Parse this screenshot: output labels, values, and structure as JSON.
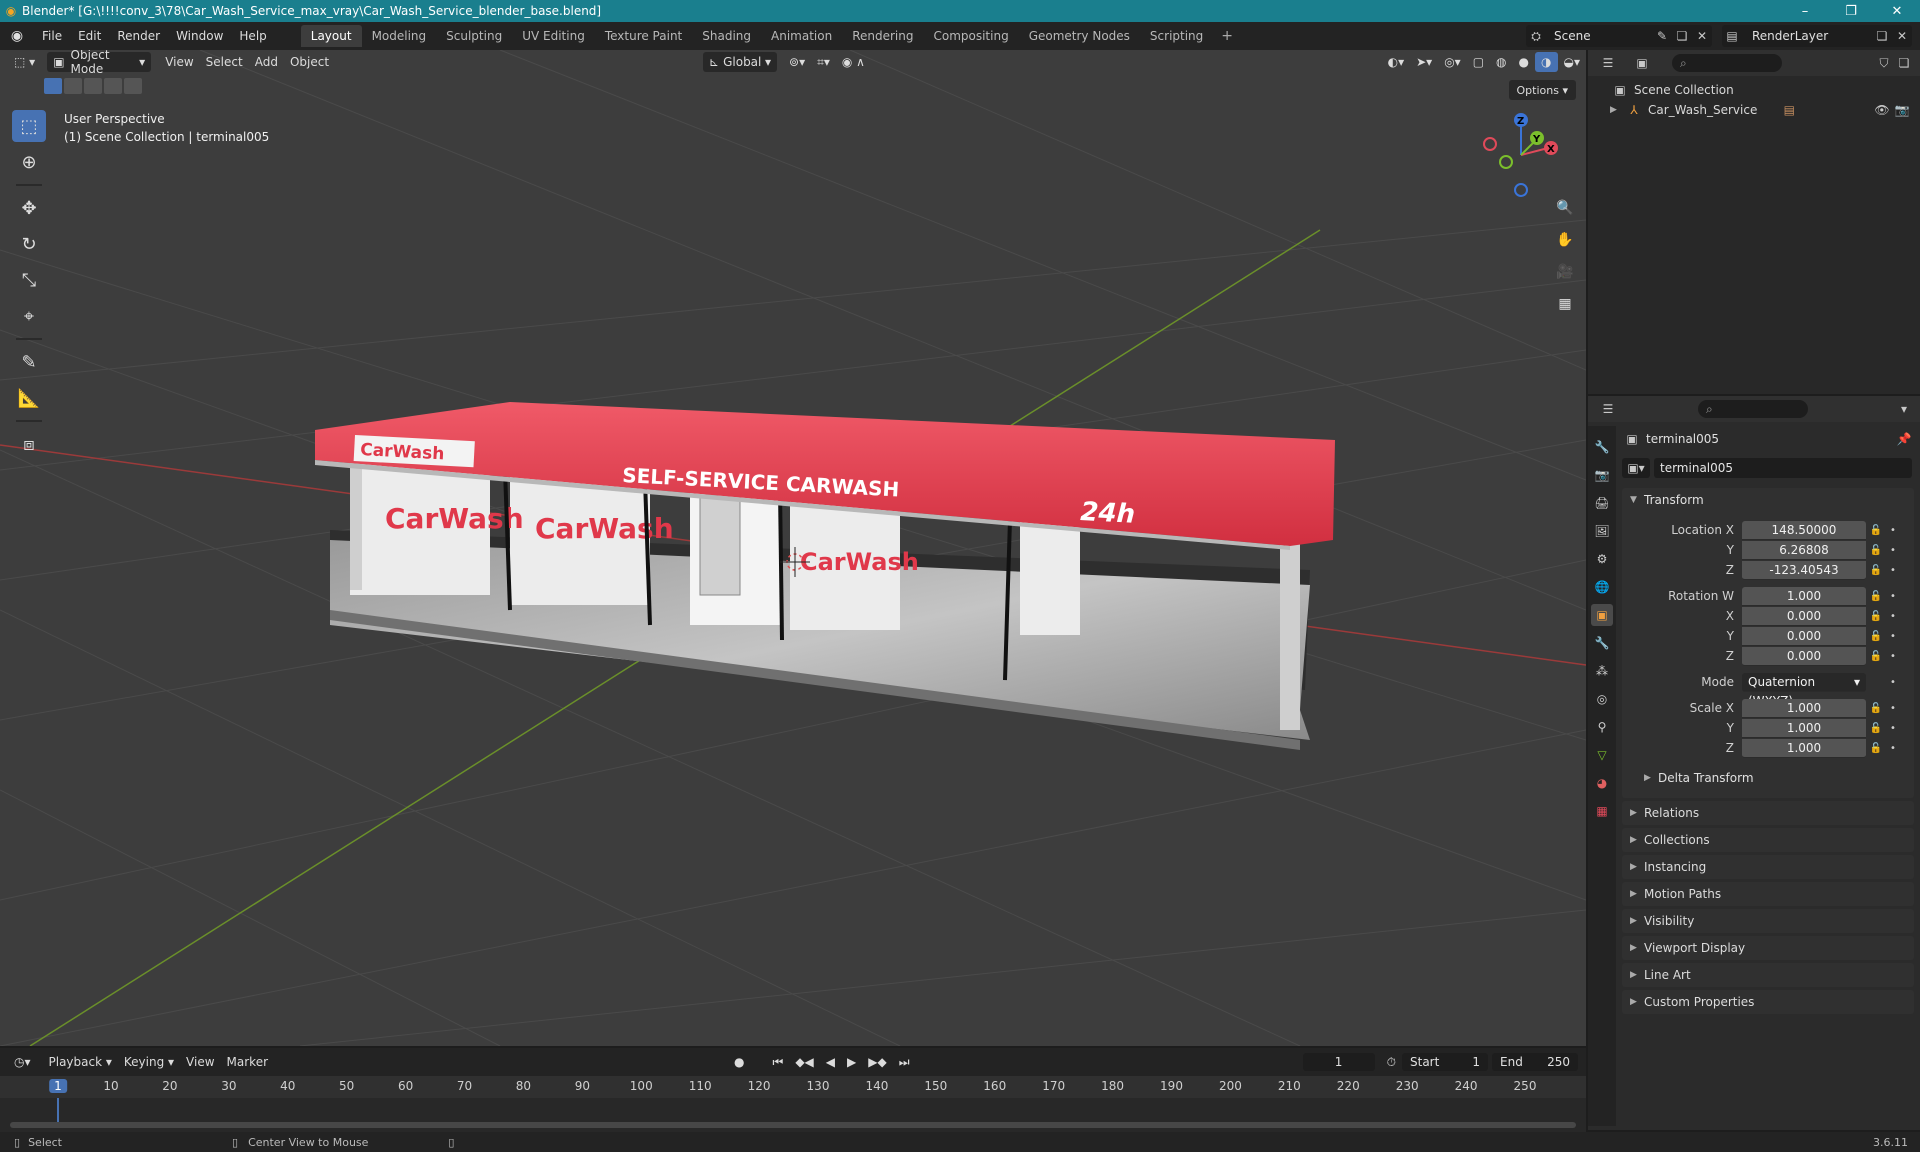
{
  "window": {
    "title": "Blender* [G:\\!!!!conv_3\\78\\Car_Wash_Service_max_vray\\Car_Wash_Service_blender_base.blend]",
    "minimize": "–",
    "maximize": "❐",
    "close": "✕"
  },
  "menu": [
    "File",
    "Edit",
    "Render",
    "Window",
    "Help"
  ],
  "workspaces": [
    "Layout",
    "Modeling",
    "Sculpting",
    "UV Editing",
    "Texture Paint",
    "Shading",
    "Animation",
    "Rendering",
    "Compositing",
    "Geometry Nodes",
    "Scripting"
  ],
  "active_workspace": "Layout",
  "workspace_add": "+",
  "scene": {
    "name": "Scene",
    "view_layer": "RenderLayer"
  },
  "viewport": {
    "mode": "Object Mode",
    "menus": [
      "View",
      "Select",
      "Add",
      "Object"
    ],
    "orientation": "Global",
    "options_label": "Options",
    "view_name": "User Perspective",
    "collection_info": "(1) Scene Collection | terminal005",
    "gizmo_axes": {
      "x": "X",
      "y": "Y",
      "z": "Z"
    }
  },
  "scene_model": {
    "roof_brand": "CarWash",
    "roof_title": "SELF-SERVICE CARWASH",
    "roof_hours": "24h",
    "banner_text": "CarWash"
  },
  "outliner": {
    "root": "Scene Collection",
    "items": [
      {
        "name": "Car_Wash_Service"
      }
    ]
  },
  "properties": {
    "object_name": "terminal005",
    "data_name": "terminal005",
    "transform_title": "Transform",
    "location": {
      "label": "Location X",
      "x": "148.50000",
      "y": "6.26808",
      "z": "-123.40543"
    },
    "rotation": {
      "label": "Rotation W",
      "w": "1.000",
      "x": "0.000",
      "y": "0.000",
      "z": "0.000"
    },
    "mode_label": "Mode",
    "mode_value": "Quaternion (WXYZ)",
    "scale": {
      "label": "Scale X",
      "x": "1.000",
      "y": "1.000",
      "z": "1.000"
    },
    "axis_labels": {
      "x": "X",
      "y": "Y",
      "z": "Z"
    },
    "delta_transform": "Delta Transform",
    "panels": [
      "Relations",
      "Collections",
      "Instancing",
      "Motion Paths",
      "Visibility",
      "Viewport Display",
      "Line Art",
      "Custom Properties"
    ]
  },
  "timeline": {
    "menus": [
      "Playback",
      "Keying",
      "View",
      "Marker"
    ],
    "current_frame": "1",
    "start_label": "Start",
    "start": "1",
    "end_label": "End",
    "end": "250",
    "ticks": [
      "1",
      "10",
      "20",
      "30",
      "40",
      "50",
      "60",
      "70",
      "80",
      "90",
      "100",
      "110",
      "120",
      "130",
      "140",
      "150",
      "160",
      "170",
      "180",
      "190",
      "200",
      "210",
      "220",
      "230",
      "240",
      "250"
    ]
  },
  "status": {
    "select": "Select",
    "center_view": "Center View to Mouse",
    "version": "3.6.11"
  },
  "colors": {
    "accent": "#4772b3",
    "title_bar": "#1a7f8e",
    "roof": "#e0384a"
  }
}
